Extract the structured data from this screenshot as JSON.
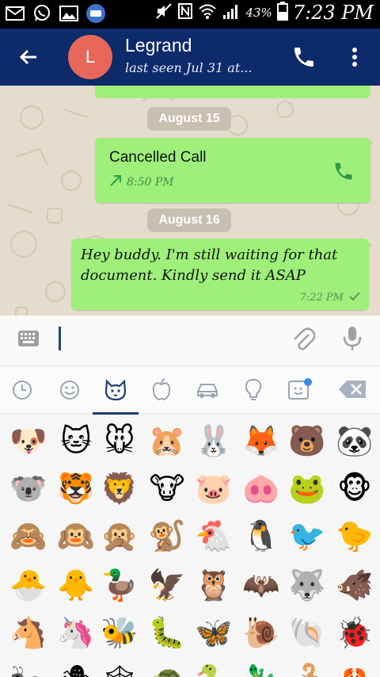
{
  "status_bar": {
    "battery": "43%",
    "time": "7:23 PM",
    "icons": [
      "mail-icon",
      "whatsapp-icon",
      "image-icon",
      "messenger-icon",
      "mute-icon",
      "nfc-icon",
      "wifi-icon",
      "signal-icon",
      "battery-icon"
    ]
  },
  "header": {
    "avatar_letter": "L",
    "contact_name": "Legrand",
    "last_seen": "last seen Jul 31 at...",
    "colors": {
      "bar": "#0d2a6b",
      "avatar": "#e8675b"
    }
  },
  "chat": {
    "colors": {
      "bubble": "#9ef07a",
      "background": "#e6dccd"
    },
    "date_1": "August 15",
    "call_bubble": {
      "title": "Cancelled Call",
      "time": "8:50 PM"
    },
    "date_2": "August 16",
    "message": {
      "text": "Hey buddy. I'm still waiting for that document. Kindly send it ASAP",
      "time": "7:22 PM"
    }
  },
  "input": {
    "value": ""
  },
  "keyboard": {
    "tabs": [
      "recent-icon",
      "smiley-icon",
      "animal-icon",
      "food-icon",
      "car-icon",
      "lightbulb-icon",
      "sticker-icon",
      "backspace-icon"
    ],
    "active_tab": "animal-icon",
    "emoji_rows": [
      [
        "🐶",
        "🐱",
        "🐭",
        "🐹",
        "🐰",
        "🦊",
        "🐻",
        "🐼"
      ],
      [
        "🐨",
        "🐯",
        "🦁",
        "🐮",
        "🐷",
        "🐽",
        "🐸",
        "🐵"
      ],
      [
        "🙈",
        "🙉",
        "🙊",
        "🐒",
        "🐔",
        "🐧",
        "🐦",
        "🐤"
      ],
      [
        "🐣",
        "🐥",
        "🦆",
        "🦅",
        "🦉",
        "🦇",
        "🐺",
        "🐗"
      ],
      [
        "🐴",
        "🦄",
        "🐝",
        "🐛",
        "🦋",
        "🐌",
        "🐚",
        "🐞"
      ],
      [
        "🐜",
        "🕷",
        "🕸",
        "🐢",
        "🐍",
        "🦎",
        "🦂",
        "🦀"
      ]
    ]
  }
}
